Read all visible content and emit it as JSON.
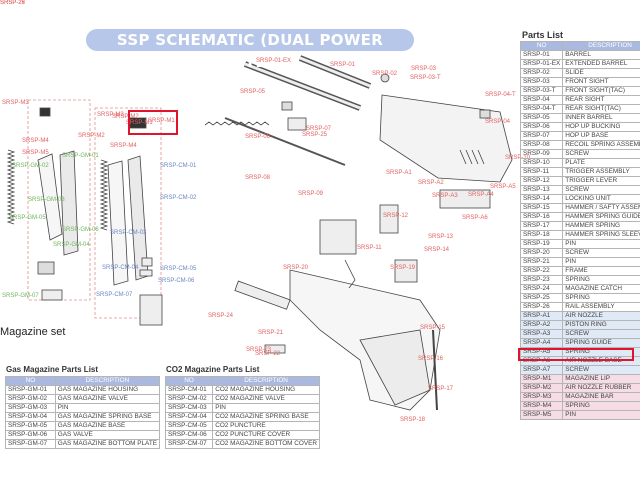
{
  "title": "SSP SCHEMATIC (DUAL POWER SYSTEM)",
  "section_label": "Magazine set",
  "colors": {
    "red": "#e26060",
    "blue": "#6c86c4",
    "green": "#6fb35e",
    "pink": "#f6dde5",
    "lightblue": "#dfeaf6",
    "highlight": "#e0142a",
    "header": "#a9b9df"
  },
  "callouts": [
    {
      "t": "SRSP-M3",
      "c": "red"
    },
    {
      "t": "SRSP-M1",
      "c": "red"
    },
    {
      "t": "SRSP-M2",
      "c": "red"
    },
    {
      "t": "SRSP-M4",
      "c": "red"
    },
    {
      "t": "SRSP-M5",
      "c": "red"
    },
    {
      "t": "SRSP-M1",
      "c": "red"
    },
    {
      "t": "SRSP-M2",
      "c": "red"
    },
    {
      "t": "SRSP-M3",
      "c": "red"
    },
    {
      "t": "SRSP-M4",
      "c": "red"
    },
    {
      "t": "SRSP-GM-01",
      "c": "green"
    },
    {
      "t": "SRSP-GM-02",
      "c": "green"
    },
    {
      "t": "SRSP-GM-03",
      "c": "green"
    },
    {
      "t": "SRSP-GM-04",
      "c": "green"
    },
    {
      "t": "SRSP-GM-05",
      "c": "green"
    },
    {
      "t": "SRSP-GM-06",
      "c": "green"
    },
    {
      "t": "SRSP-GM-07",
      "c": "green"
    },
    {
      "t": "SRSP-CM-01",
      "c": "blue"
    },
    {
      "t": "SRSP-CM-02",
      "c": "blue"
    },
    {
      "t": "SRSP-CM-03",
      "c": "blue"
    },
    {
      "t": "SRSP-CM-04",
      "c": "blue"
    },
    {
      "t": "SRSP-CM-05",
      "c": "blue"
    },
    {
      "t": "SRSP-CM-06",
      "c": "blue"
    },
    {
      "t": "SRSP-CM-07",
      "c": "blue"
    },
    {
      "t": "SRSP-01-EX",
      "c": "red"
    },
    {
      "t": "SRSP-01",
      "c": "red"
    },
    {
      "t": "SRSP-02",
      "c": "red"
    },
    {
      "t": "SRSP-03",
      "c": "red"
    },
    {
      "t": "SRSP-03-T",
      "c": "red"
    },
    {
      "t": "SRSP-04",
      "c": "red"
    },
    {
      "t": "SRSP-04-T",
      "c": "red"
    },
    {
      "t": "SRSP-05",
      "c": "red"
    },
    {
      "t": "SRSP-06",
      "c": "red"
    },
    {
      "t": "SRSP-07",
      "c": "red"
    },
    {
      "t": "SRSP-08",
      "c": "red"
    },
    {
      "t": "SRSP-09",
      "c": "red"
    },
    {
      "t": "SRSP-10",
      "c": "red"
    },
    {
      "t": "SRSP-A1",
      "c": "red"
    },
    {
      "t": "SRSP-A2",
      "c": "red"
    },
    {
      "t": "SRSP-A3",
      "c": "red"
    },
    {
      "t": "SRSP-A4",
      "c": "red"
    },
    {
      "t": "SRSP-A5",
      "c": "red"
    },
    {
      "t": "SRSP-A6",
      "c": "red"
    },
    {
      "t": "SRSP-11",
      "c": "red"
    },
    {
      "t": "SRSP-12",
      "c": "red"
    },
    {
      "t": "SRSP-13",
      "c": "red"
    },
    {
      "t": "SRSP-14",
      "c": "red"
    },
    {
      "t": "SRSP-15",
      "c": "red"
    },
    {
      "t": "SRSP-16",
      "c": "red"
    },
    {
      "t": "SRSP-17",
      "c": "red"
    },
    {
      "t": "SRSP-18",
      "c": "red"
    },
    {
      "t": "SRSP-19",
      "c": "red"
    },
    {
      "t": "SRSP-20",
      "c": "red"
    },
    {
      "t": "SRSP-21",
      "c": "red"
    },
    {
      "t": "SRSP-22",
      "c": "red"
    },
    {
      "t": "SRSP-23",
      "c": "red"
    },
    {
      "t": "SRSP-24",
      "c": "red"
    },
    {
      "t": "SRSP-25",
      "c": "red"
    },
    {
      "t": "SRSP-26",
      "c": "red"
    },
    {
      "t": "SRSP-27",
      "c": "red"
    }
  ],
  "parts_list": {
    "title": "Parts List",
    "headers": [
      "NO",
      "DESCRIPTION"
    ],
    "rows": [
      [
        "SRSP-01",
        "BARREL"
      ],
      [
        "SRSP-01-EX",
        "EXTENDED BARREL"
      ],
      [
        "SRSP-02",
        "SLIDE"
      ],
      [
        "SRSP-03",
        "FRONT SIGHT"
      ],
      [
        "SRSP-03-T",
        "FRONT SIGHT(TAC)"
      ],
      [
        "SRSP-04",
        "REAR SIGHT"
      ],
      [
        "SRSP-04-T",
        "REAR SIGHT(TAC)"
      ],
      [
        "SRSP-05",
        "INNER BARREL"
      ],
      [
        "SRSP-06",
        "HOP UP BUCKING"
      ],
      [
        "SRSP-07",
        "HOP UP BASE"
      ],
      [
        "SRSP-08",
        "RECOIL SPRING ASSEMBLY"
      ],
      [
        "SRSP-09",
        "SCREW"
      ],
      [
        "SRSP-10",
        "PLATE"
      ],
      [
        "SRSP-11",
        "TRIGGER ASSEMBLY"
      ],
      [
        "SRSP-12",
        "TRIGGER LEVER"
      ],
      [
        "SRSP-13",
        "SCREW"
      ],
      [
        "SRSP-14",
        "LOCKING UNIT"
      ],
      [
        "SRSP-15",
        "HAMMER / SAFTY ASSEMBLY"
      ],
      [
        "SRSP-16",
        "HAMMER SPRING GUIDE"
      ],
      [
        "SRSP-17",
        "HAMMER SPRING"
      ],
      [
        "SRSP-18",
        "HAMMER SPRING SLEEVE"
      ],
      [
        "SRSP-19",
        "PIN"
      ],
      [
        "SRSP-20",
        "SCREW"
      ],
      [
        "SRSP-21",
        "PIN"
      ],
      [
        "SRSP-22",
        "FRAME"
      ],
      [
        "SRSP-23",
        "SPRING"
      ],
      [
        "SRSP-24",
        "MAGAZINE CATCH"
      ],
      [
        "SRSP-25",
        "SPRING"
      ],
      [
        "SRSP-26",
        "RAIL ASSEMBLY"
      ],
      [
        "SRSP-A1",
        "AIR NOZZLE"
      ],
      [
        "SRSP-A2",
        "PISTON RING"
      ],
      [
        "SRSP-A3",
        "SCREW"
      ],
      [
        "SRSP-A4",
        "SPRING GUIDE"
      ],
      [
        "SRSP-A5",
        "SPRING"
      ],
      [
        "SRSP-A6",
        "AIR NOZZLE BASE"
      ],
      [
        "SRSP-A7",
        "SCREW"
      ],
      [
        "SRSP-M1",
        "MAGAZINE LIP"
      ],
      [
        "SRSP-M2",
        "AIR NOZZLE RUBBER"
      ],
      [
        "SRSP-M3",
        "MAGAZINE BAR"
      ],
      [
        "SRSP-M4",
        "SPRING"
      ],
      [
        "SRSP-M5",
        "PIN"
      ]
    ]
  },
  "gas_list": {
    "title": "Gas Magazine Parts List",
    "headers": [
      "NO",
      "DESCRIPTION"
    ],
    "rows": [
      [
        "SRSP-GM-01",
        "GAS MAGAZINE HOUSING"
      ],
      [
        "SRSP-GM-02",
        "GAS MAGAZINE VALVE"
      ],
      [
        "SRSP-GM-03",
        "PIN"
      ],
      [
        "SRSP-GM-04",
        "GAS MAGAZINE SPRING BASE"
      ],
      [
        "SRSP-GM-05",
        "GAS MAGAZINE BASE"
      ],
      [
        "SRSP-GM-06",
        "GAS VALVE"
      ],
      [
        "SRSP-GM-07",
        "GAS MAGAZINE BOTTOM PLATE"
      ]
    ]
  },
  "co2_list": {
    "title": "CO2 Magazine Parts List",
    "headers": [
      "NO",
      "DESCRIPTION"
    ],
    "rows": [
      [
        "SRSP-CM-01",
        "CO2 MAGAZINE HOUSING"
      ],
      [
        "SRSP-CM-02",
        "CO2 MAGAZINE VALVE"
      ],
      [
        "SRSP-CM-03",
        "PIN"
      ],
      [
        "SRSP-CM-04",
        "CO2 MAGAZINE SPRING BASE"
      ],
      [
        "SRSP-CM-05",
        "CO2 PUNCTURE"
      ],
      [
        "SRSP-CM-06",
        "CO2 PUNCTURE COVER"
      ],
      [
        "SRSP-CM-07",
        "CO2 MAGAZINE BOTTOM COVER"
      ]
    ]
  }
}
